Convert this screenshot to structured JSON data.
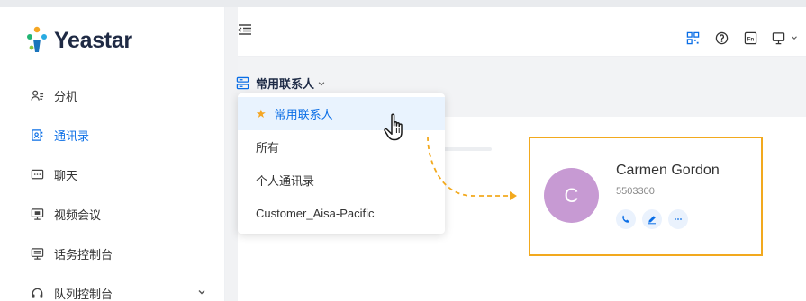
{
  "logo": {
    "text": "Yeastar"
  },
  "sidebar": {
    "items": [
      {
        "label": "分机",
        "icon": "user-list-icon"
      },
      {
        "label": "通讯录",
        "icon": "contacts-book-icon",
        "active": true
      },
      {
        "label": "聊天",
        "icon": "chat-icon"
      },
      {
        "label": "视频会议",
        "icon": "video-conference-icon"
      },
      {
        "label": "话务控制台",
        "icon": "operator-console-icon"
      },
      {
        "label": "队列控制台",
        "icon": "headset-icon"
      }
    ]
  },
  "header": {
    "icons": [
      "qr-code-icon",
      "help-icon",
      "fn-key-icon",
      "monitor-icon"
    ]
  },
  "filter": {
    "label": "常用联系人"
  },
  "dropdown": {
    "items": [
      {
        "label": "常用联系人",
        "selected": true
      },
      {
        "label": "所有"
      },
      {
        "label": "个人通讯录"
      },
      {
        "label": "Customer_Aisa-Pacific"
      }
    ]
  },
  "contact": {
    "initial": "C",
    "name": "Carmen Gordon",
    "extension": "5503300",
    "actions": [
      "phone-icon",
      "edit-icon",
      "more-icon"
    ]
  },
  "colors": {
    "accent": "#0a6ee6",
    "highlight_border": "#f2a91e",
    "avatar": "#c79ad3",
    "star": "#f5a623"
  }
}
